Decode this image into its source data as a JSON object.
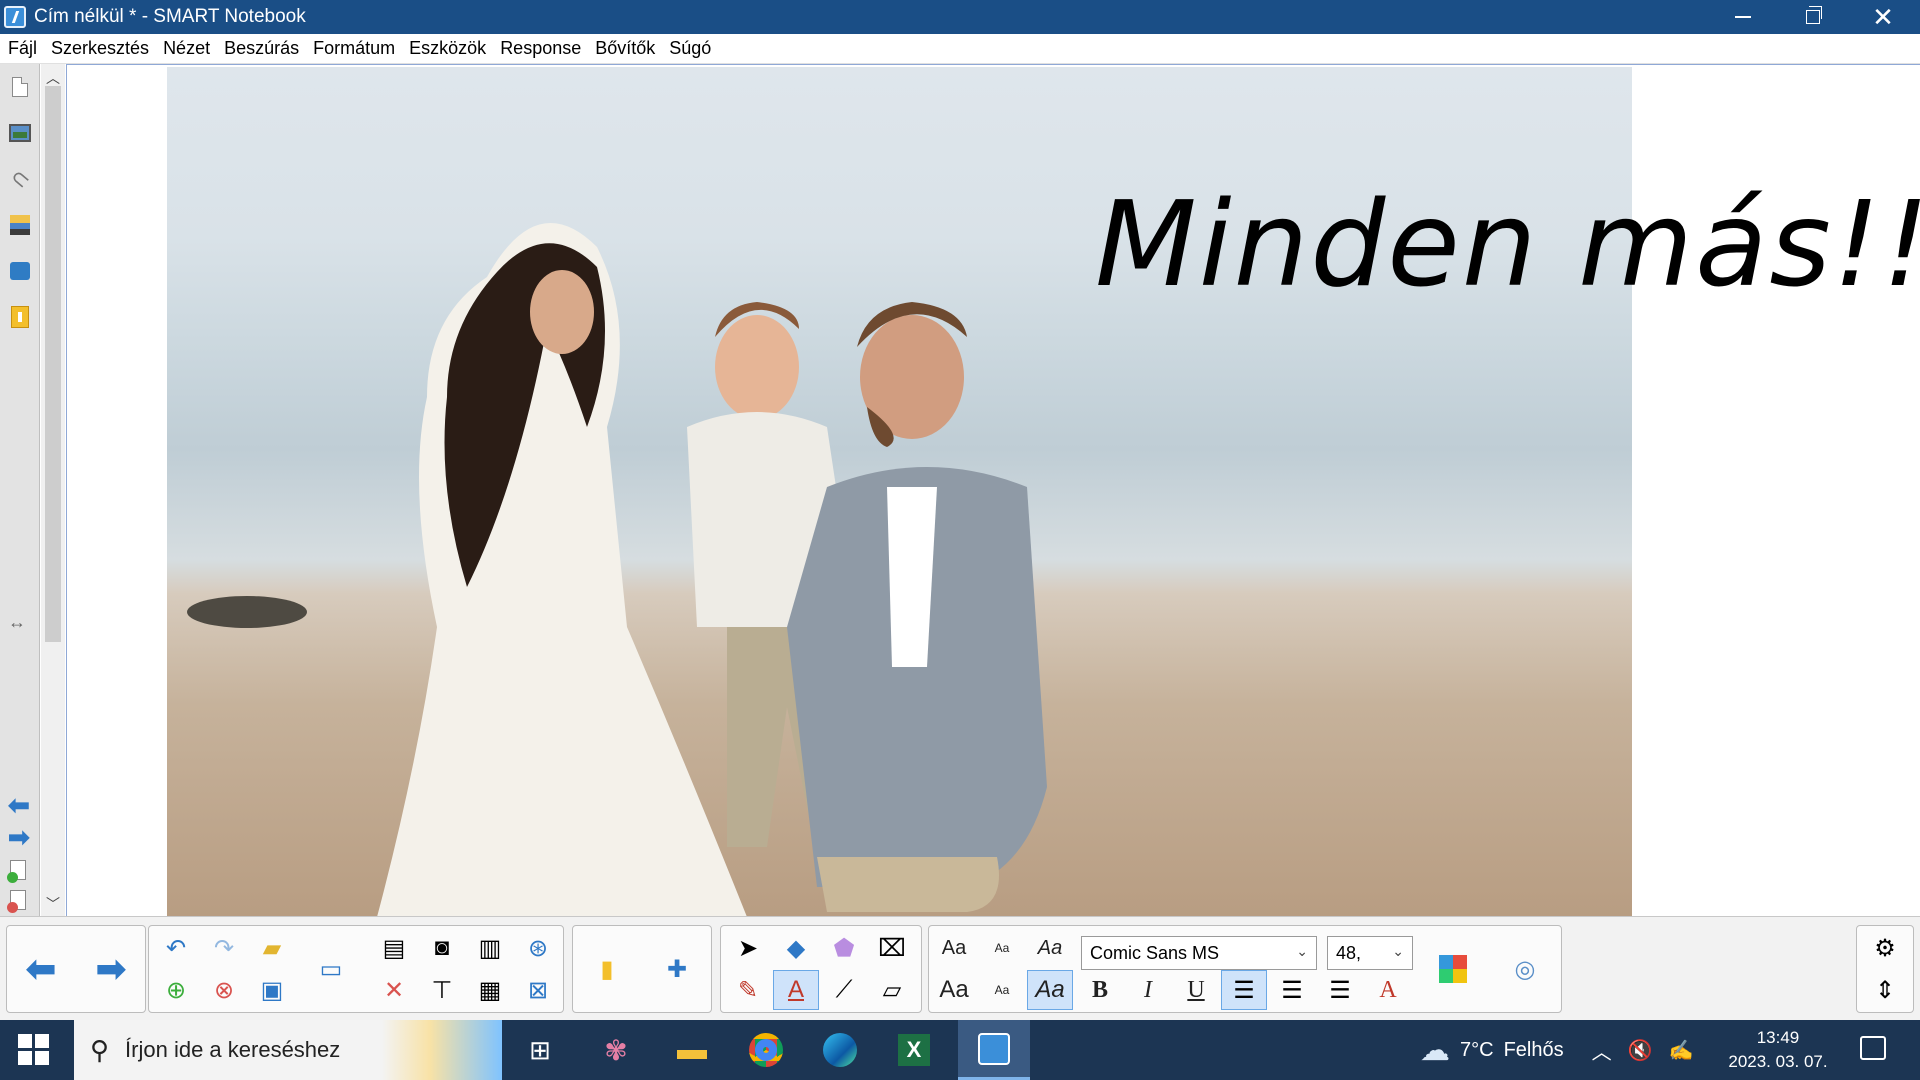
{
  "window": {
    "title": "Cím nélkül * - SMART Notebook"
  },
  "menu": [
    "Fájl",
    "Szerkesztés",
    "Nézet",
    "Beszúrás",
    "Formátum",
    "Eszközök",
    "Response",
    "Bővítők",
    "Súgó"
  ],
  "slide": {
    "text": "Minden más!!"
  },
  "toolbar": {
    "font_name": "Comic Sans MS",
    "font_size": "48,",
    "font_preview": "Aa",
    "font_preview_small": "Aa",
    "bold_label": "B",
    "italic_label": "I",
    "underline_label": "U"
  },
  "taskbar": {
    "search_placeholder": "Írjon ide a kereséshez",
    "weather_temp": "7°C",
    "weather_text": "Felhős",
    "time": "13:49",
    "date": "2023. 03. 07."
  },
  "colors": {
    "titlebar": "#1a4e86",
    "taskbar": "#1c3553",
    "accent": "#2e78c6"
  }
}
